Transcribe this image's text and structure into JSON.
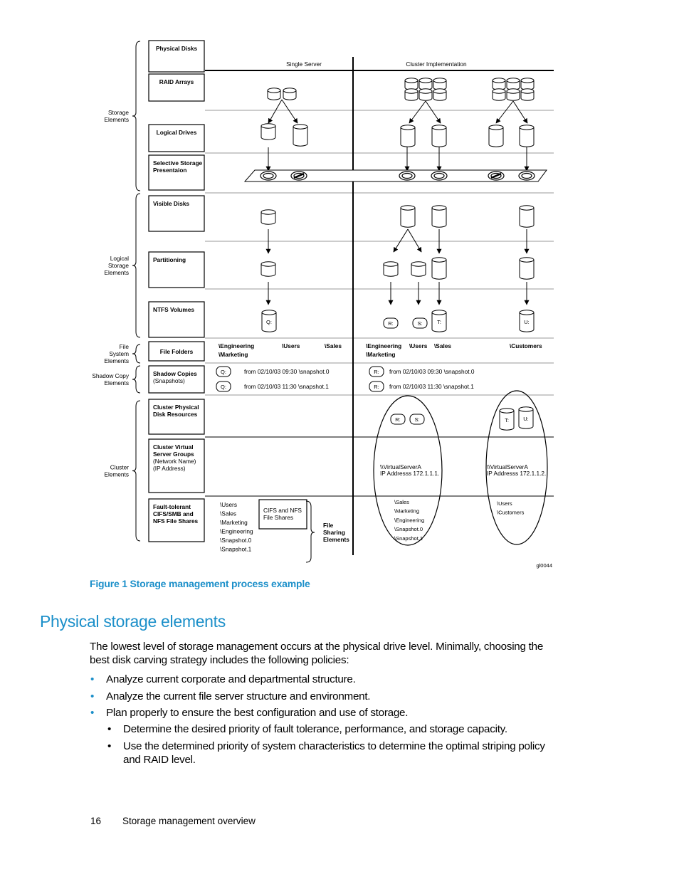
{
  "figure": {
    "column_headers": {
      "single": "Single Server",
      "cluster": "Cluster Implementation"
    },
    "brackets": [
      {
        "id": "storage",
        "lines": [
          "Storage",
          "Elements"
        ]
      },
      {
        "id": "logical",
        "lines": [
          "Logical",
          "Storage",
          "Elements"
        ]
      },
      {
        "id": "filesystem",
        "lines": [
          "File",
          "System",
          "Elements"
        ]
      },
      {
        "id": "shadow",
        "lines": [
          "Shadow Copy",
          "Elements"
        ]
      },
      {
        "id": "cluster",
        "lines": [
          "Cluster",
          "Elements"
        ]
      }
    ],
    "stage_boxes": [
      {
        "lines": [
          "Physical Disks"
        ]
      },
      {
        "lines": [
          "RAID Arrays"
        ]
      },
      {
        "lines": [
          "Logical Drives"
        ]
      },
      {
        "lines": [
          "Selective Storage",
          "Presentaion"
        ]
      },
      {
        "lines": [
          "Visible Disks"
        ]
      },
      {
        "lines": [
          "Partitioning"
        ]
      },
      {
        "lines": [
          "NTFS Volumes"
        ]
      },
      {
        "lines": [
          "File Folders"
        ]
      },
      {
        "lines": [
          "Shadow Copies"
        ],
        "sub": [
          "(Snapshots)"
        ]
      },
      {
        "lines": [
          "Cluster Physical",
          "Disk Resources"
        ]
      },
      {
        "lines": [
          "Cluster Virtual",
          "Server Groups"
        ],
        "sub": [
          "(Network Name)",
          "(IP Address)"
        ]
      },
      {
        "lines": [
          "Fault-tolerant",
          "CIFS/SMB and",
          "NFS File Shares"
        ]
      }
    ],
    "volumes": {
      "q": "Q:",
      "r": "R:",
      "s": "S:",
      "t": "T:",
      "u": "U:"
    },
    "folders_single": {
      "engineering": "\\Engineering",
      "users": "\\Users",
      "sales": "\\Sales",
      "marketing": "\\Marketing"
    },
    "folders_cluster": {
      "engineering": "\\Engineering",
      "users": "\\Users",
      "sales": "\\Sales",
      "marketing": "\\Marketing",
      "customers": "\\Customers"
    },
    "snapshots": {
      "s0": "from 02/10/03 09:30 \\snapshot.0",
      "s1": "from 02/10/03 11:30 \\snapshot.1"
    },
    "virtual_servers": [
      {
        "name": "\\\\VirtualServerA",
        "ip": "IP Addresss 172.1.1.1.",
        "shares": [
          "\\Sales",
          "\\Marketing",
          "\\Engineering",
          "\\Snapshot.0",
          "\\Snapshot.1"
        ]
      },
      {
        "name": "\\\\VirtualServerA",
        "ip": "IP Addresss 172.1.1.2.",
        "shares": [
          "\\Users",
          "\\Customers"
        ]
      }
    ],
    "single_shares": [
      "\\Users",
      "\\Sales",
      "\\Marketing",
      "\\Engineering",
      "\\Snapshot.0",
      "\\Snapshot.1"
    ],
    "cifs_box": [
      "CIFS and NFS",
      "File Shares"
    ],
    "file_sharing_bracket": [
      "File",
      "Sharing",
      "Elements"
    ],
    "figure_id": "gl0044"
  },
  "caption": "Figure 1 Storage management process example",
  "section": {
    "heading": "Physical storage elements",
    "intro": "The lowest level of storage management occurs at the physical drive level. Minimally, choosing the best disk carving strategy includes the following policies:",
    "bullets": [
      "Analyze current corporate and departmental structure.",
      "Analyze the current file server structure and environment.",
      "Plan properly to ensure the best configuration and use of storage."
    ],
    "sub_bullets": [
      "Determine the desired priority of fault tolerance, performance, and storage capacity.",
      "Use the determined priority of system characteristics to determine the optimal striping policy and RAID level."
    ],
    "bullet_color": "#1b8fc9",
    "accent_color": "#1b8fc9"
  },
  "footer": {
    "page_number": "16",
    "chapter": "Storage management overview"
  }
}
